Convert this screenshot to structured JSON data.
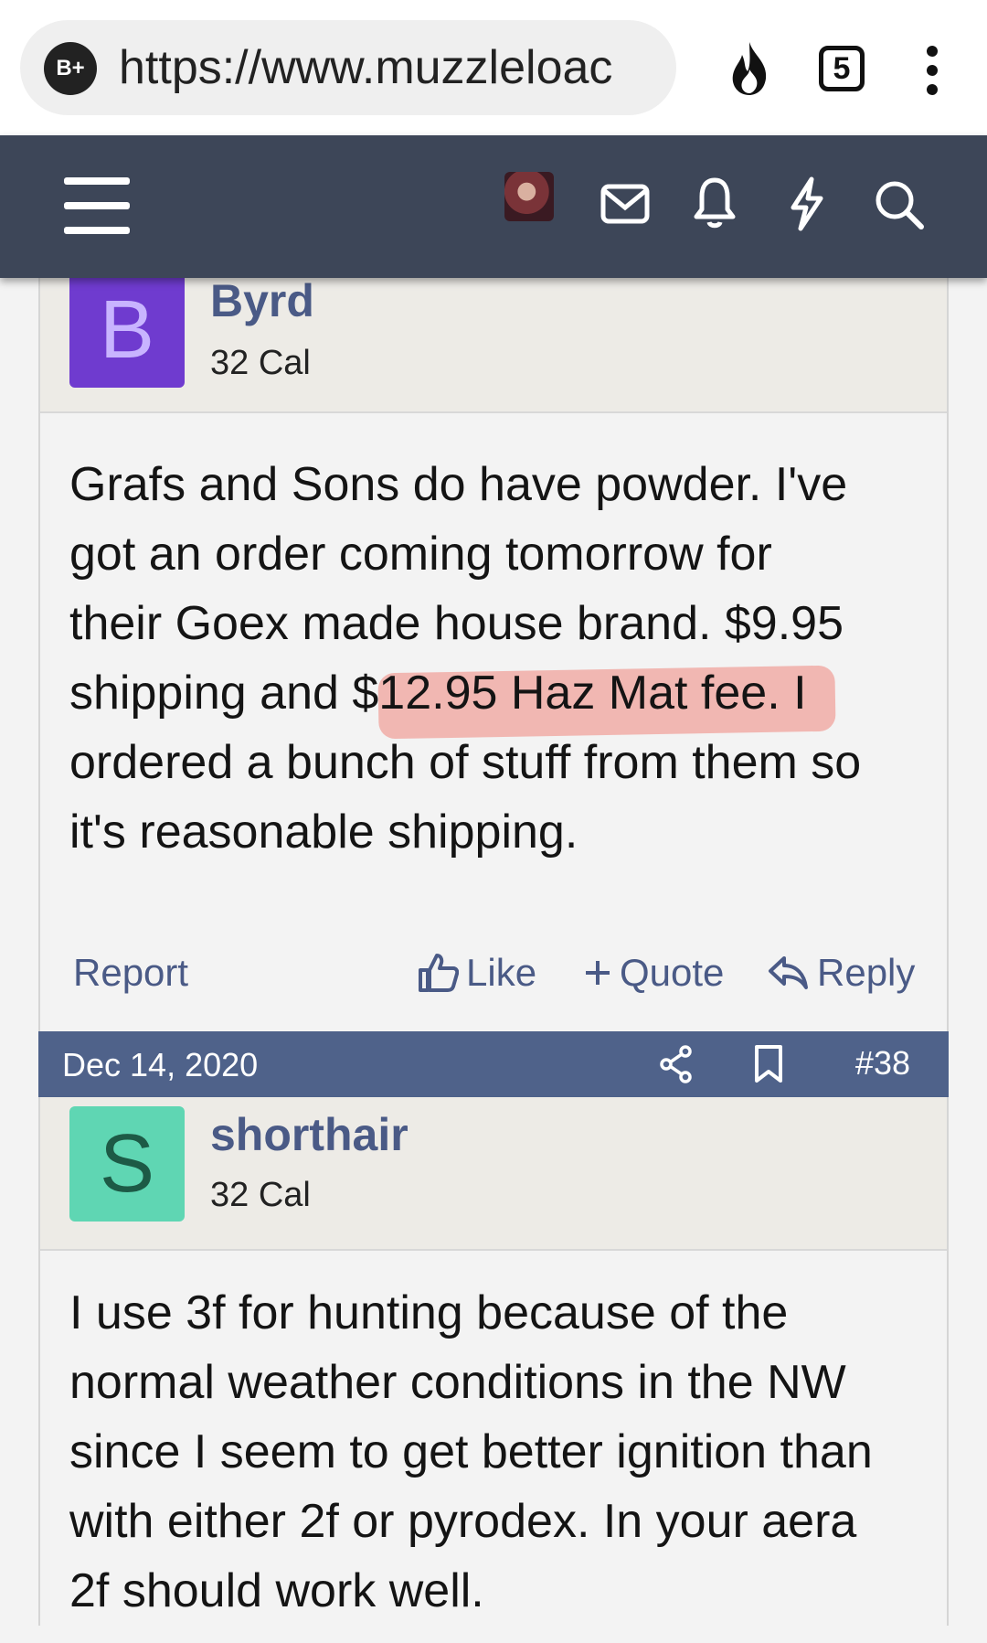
{
  "browser": {
    "site_badge": "B+",
    "url": "https://www.muzzleloac",
    "tabs_count": "5",
    "icons": [
      "fire-icon",
      "tabs-icon",
      "more-vert-icon"
    ]
  },
  "nav": {
    "icons": [
      "menu-icon",
      "avatar",
      "mail-icon",
      "bell-icon",
      "bolt-icon",
      "search-icon"
    ]
  },
  "posts": [
    {
      "avatar_letter": "B",
      "avatar_color": "#6f3bcf",
      "username": "Byrd",
      "user_title": "32 Cal",
      "body_lines": [
        "Grafs and Sons do have powder. I've",
        "got an order coming tomorrow for",
        "their Goex made house brand. $9.95",
        "shipping and $12.95 Haz Mat fee. I",
        "ordered a bunch of stuff from them so",
        "it's reasonable shipping."
      ],
      "actions": {
        "report": "Report",
        "like": "Like",
        "quote": "Quote",
        "reply": "Reply"
      }
    },
    {
      "date": "Dec 14, 2020",
      "post_number": "#38",
      "avatar_letter": "S",
      "avatar_color": "#5fd6b3",
      "username": "shorthair",
      "user_title": "32 Cal",
      "body_lines": [
        "I use 3f for hunting because of the",
        "normal weather conditions in the NW",
        "since I seem to get better ignition than",
        "with either 2f or pyrodex. In your aera",
        "2f should work well."
      ]
    }
  ],
  "colors": {
    "nav_bg": "#3d4658",
    "post_bar": "#4f628a",
    "link": "#4a5a86",
    "highlight": "#f06e64"
  }
}
